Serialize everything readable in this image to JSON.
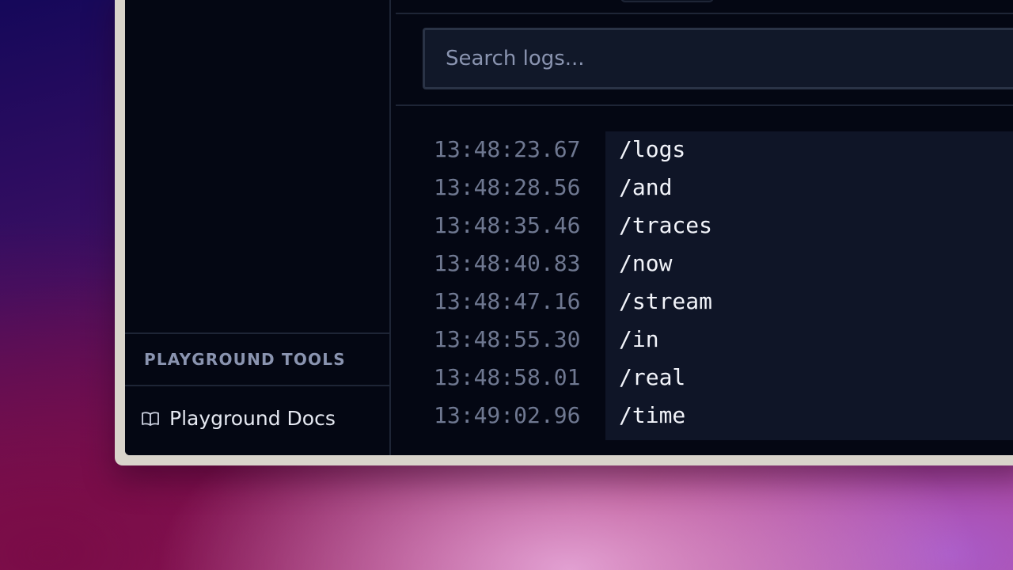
{
  "sidebar": {
    "section_title": "PLAYGROUND TOOLS",
    "items": [
      {
        "label": "Playground Docs",
        "icon": "book-open-icon"
      }
    ]
  },
  "search": {
    "placeholder": "Search logs...",
    "value": ""
  },
  "logs": [
    {
      "time": "13:48:23.67",
      "path": "/logs"
    },
    {
      "time": "13:48:28.56",
      "path": "/and"
    },
    {
      "time": "13:48:35.46",
      "path": "/traces"
    },
    {
      "time": "13:48:40.83",
      "path": "/now"
    },
    {
      "time": "13:48:47.16",
      "path": "/stream"
    },
    {
      "time": "13:48:55.30",
      "path": "/in"
    },
    {
      "time": "13:48:58.01",
      "path": "/real"
    },
    {
      "time": "13:49:02.96",
      "path": "/time"
    }
  ],
  "colors": {
    "window_bg": "#040713",
    "border": "#1e2536",
    "input_bg": "#111829",
    "muted_text": "#6f7891",
    "primary_text": "#f2f4fa",
    "frame": "#d9d4cb"
  }
}
